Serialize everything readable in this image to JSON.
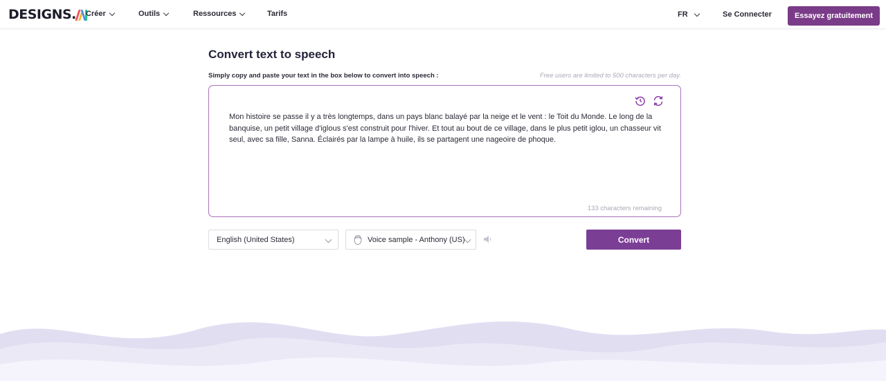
{
  "header": {
    "logo_text": "DESIGNS.",
    "nav": [
      {
        "label": "Créer",
        "has_dropdown": true
      },
      {
        "label": "Outils",
        "has_dropdown": true
      },
      {
        "label": "Ressources",
        "has_dropdown": true
      },
      {
        "label": "Tarifs",
        "has_dropdown": false
      }
    ],
    "language": "FR",
    "login": "Se Connecter",
    "cta": "Essayez gratuitement",
    "colors": {
      "cta": "#7a3b88"
    }
  },
  "main": {
    "title": "Convert text to speech",
    "instructions": "Simply copy and paste your text in the box below to convert into speech :",
    "limit_note": "Free users are limited to 500 characters per day.",
    "text": "Mon histoire se passe il y a très longtemps, dans un pays blanc balayé par la neige et le vent : le Toit du Monde. Le long de la banquise, un petit village d'iglous s'est construit pour l'hiver. Et tout au bout de ce village, dans le plus petit iglou, un chasseur vit seul, avec sa fille, Sanna. Éclairés par la lampe à huile, ils se partagent une nageoire de phoque.",
    "remaining": "133 characters remaining",
    "icons": [
      "history-icon",
      "refresh-icon"
    ],
    "language_select": "English (United States)",
    "voice_select": "Voice sample - Anthony (US)",
    "convert_label": "Convert",
    "colors": {
      "accent": "#7b3e95",
      "border": "#a870b8"
    }
  }
}
